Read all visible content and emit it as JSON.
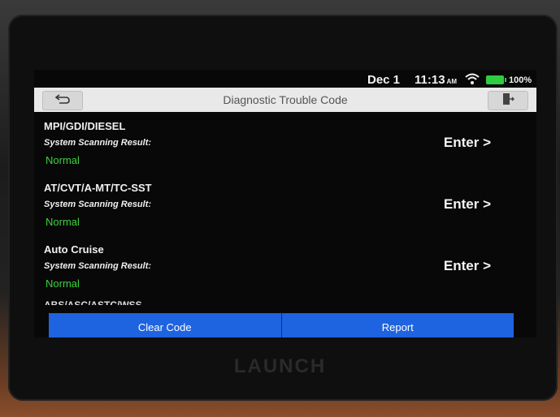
{
  "status": {
    "date": "Dec 1",
    "time": "11:13",
    "ampm": "AM",
    "battery": "100%"
  },
  "header": {
    "title": "Diagnostic Trouble Code"
  },
  "items": [
    {
      "name": "MPI/GDI/DIESEL",
      "label": "System Scanning Result:",
      "status": "Normal",
      "action": "Enter >"
    },
    {
      "name": "AT/CVT/A-MT/TC-SST",
      "label": "System Scanning Result:",
      "status": "Normal",
      "action": "Enter >"
    },
    {
      "name": "Auto Cruise",
      "label": "System Scanning Result:",
      "status": "Normal",
      "action": "Enter >"
    },
    {
      "name": "ABS/ASC/ASTC/WSS",
      "label": "",
      "status": "",
      "action": ""
    }
  ],
  "buttons": {
    "clear": "Clear Code",
    "report": "Report"
  },
  "brand": "LAUNCH",
  "colors": {
    "accent": "#1e63e0",
    "status_ok": "#3cd23c",
    "titlebar": "#e9e9e9"
  },
  "icons": [
    "back-icon",
    "exit-icon",
    "wifi-icon",
    "battery-icon"
  ]
}
